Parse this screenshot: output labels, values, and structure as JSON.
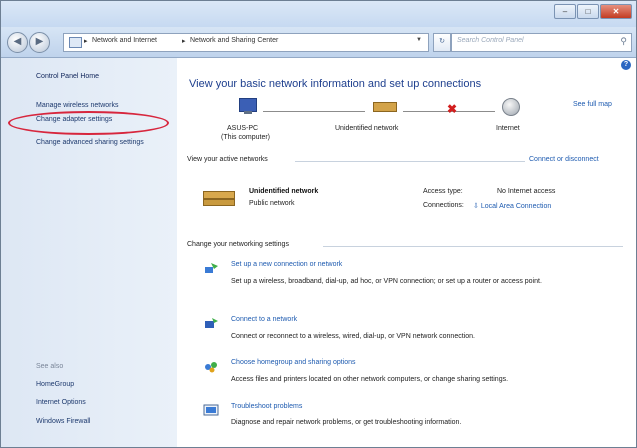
{
  "window": {
    "buttons": [
      "–",
      "□",
      "✕"
    ]
  },
  "navbar": {
    "crumbs": [
      "Network and Internet",
      "Network and Sharing Center"
    ],
    "search_placeholder": "Search Control Panel",
    "icons": [
      "back-icon",
      "forward-icon",
      "control-panel-icon",
      "refresh-icon",
      "search-icon"
    ]
  },
  "sidebar": {
    "home": "Control Panel Home",
    "links": [
      "Manage wireless networks",
      "Change adapter settings",
      "Change advanced sharing settings"
    ],
    "see_also_title": "See also",
    "see_also": [
      "HomeGroup",
      "Internet Options",
      "Windows Firewall"
    ],
    "highlight_color": "#d7263d"
  },
  "main": {
    "heading": "View your basic network information and set up connections",
    "see_full_map": "See full map",
    "map": {
      "computer_name": "ASUS-PC",
      "computer_sub": "(This computer)",
      "network": "Unidentified network",
      "internet": "Internet"
    },
    "active_title": "View your active networks",
    "connect_link": "Connect or disconnect",
    "active": {
      "name": "Unidentified network",
      "type": "Public network",
      "access_label": "Access type:",
      "access_value": "No Internet access",
      "connections_label": "Connections:",
      "connections_value": "Local Area Connection"
    },
    "settings_title": "Change your networking settings",
    "tasks": [
      {
        "title": "Set up a new connection or network",
        "desc": "Set up a wireless, broadband, dial-up, ad hoc, or VPN connection; or set up a router or access point.",
        "icon": "new-connection-icon"
      },
      {
        "title": "Connect to a network",
        "desc": "Connect or reconnect to a wireless, wired, dial-up, or VPN network connection.",
        "icon": "connect-network-icon"
      },
      {
        "title": "Choose homegroup and sharing options",
        "desc": "Access files and printers located on other network computers, or change sharing settings.",
        "icon": "homegroup-icon"
      },
      {
        "title": "Troubleshoot problems",
        "desc": "Diagnose and repair network problems, or get troubleshooting information.",
        "icon": "troubleshoot-icon"
      }
    ],
    "accent_color": "#1e3f8e",
    "link_color": "#1e5bb0"
  }
}
